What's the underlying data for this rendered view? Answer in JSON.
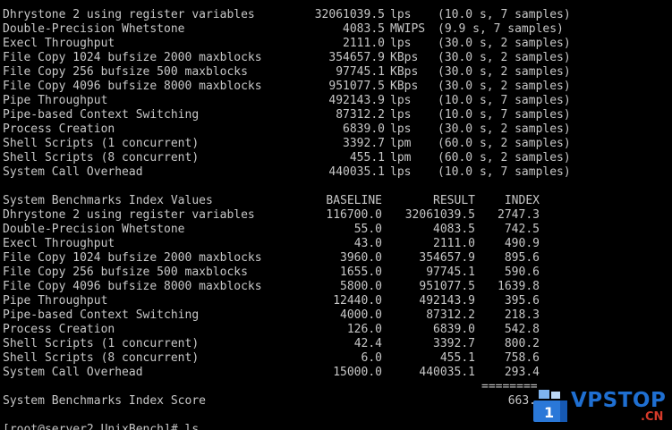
{
  "terminal": {
    "results": [
      {
        "name": "Dhrystone 2 using register variables",
        "value": "32061039.5",
        "unit": "lps",
        "detail": "(10.0 s, 7 samples)"
      },
      {
        "name": "Double-Precision Whetstone",
        "value": "4083.5",
        "unit": "MWIPS",
        "detail": "(9.9 s, 7 samples)"
      },
      {
        "name": "Execl Throughput",
        "value": "2111.0",
        "unit": "lps",
        "detail": "(30.0 s, 2 samples)"
      },
      {
        "name": "File Copy 1024 bufsize 2000 maxblocks",
        "value": "354657.9",
        "unit": "KBps",
        "detail": "(30.0 s, 2 samples)"
      },
      {
        "name": "File Copy 256 bufsize 500 maxblocks",
        "value": "97745.1",
        "unit": "KBps",
        "detail": "(30.0 s, 2 samples)"
      },
      {
        "name": "File Copy 4096 bufsize 8000 maxblocks",
        "value": "951077.5",
        "unit": "KBps",
        "detail": "(30.0 s, 2 samples)"
      },
      {
        "name": "Pipe Throughput",
        "value": "492143.9",
        "unit": "lps",
        "detail": "(10.0 s, 7 samples)"
      },
      {
        "name": "Pipe-based Context Switching",
        "value": "87312.2",
        "unit": "lps",
        "detail": "(10.0 s, 7 samples)"
      },
      {
        "name": "Process Creation",
        "value": "6839.0",
        "unit": "lps",
        "detail": "(30.0 s, 2 samples)"
      },
      {
        "name": "Shell Scripts (1 concurrent)",
        "value": "3392.7",
        "unit": "lpm",
        "detail": "(60.0 s, 2 samples)"
      },
      {
        "name": "Shell Scripts (8 concurrent)",
        "value": "455.1",
        "unit": "lpm",
        "detail": "(60.0 s, 2 samples)"
      },
      {
        "name": "System Call Overhead",
        "value": "440035.1",
        "unit": "lps",
        "detail": "(10.0 s, 7 samples)"
      }
    ],
    "index_header": {
      "title": "System Benchmarks Index Values",
      "baseline": "BASELINE",
      "result": "RESULT",
      "index": "INDEX"
    },
    "index_rows": [
      {
        "name": "Dhrystone 2 using register variables",
        "baseline": "116700.0",
        "result": "32061039.5",
        "index": "2747.3"
      },
      {
        "name": "Double-Precision Whetstone",
        "baseline": "55.0",
        "result": "4083.5",
        "index": "742.5"
      },
      {
        "name": "Execl Throughput",
        "baseline": "43.0",
        "result": "2111.0",
        "index": "490.9"
      },
      {
        "name": "File Copy 1024 bufsize 2000 maxblocks",
        "baseline": "3960.0",
        "result": "354657.9",
        "index": "895.6"
      },
      {
        "name": "File Copy 256 bufsize 500 maxblocks",
        "baseline": "1655.0",
        "result": "97745.1",
        "index": "590.6"
      },
      {
        "name": "File Copy 4096 bufsize 8000 maxblocks",
        "baseline": "5800.0",
        "result": "951077.5",
        "index": "1639.8"
      },
      {
        "name": "Pipe Throughput",
        "baseline": "12440.0",
        "result": "492143.9",
        "index": "395.6"
      },
      {
        "name": "Pipe-based Context Switching",
        "baseline": "4000.0",
        "result": "87312.2",
        "index": "218.3"
      },
      {
        "name": "Process Creation",
        "baseline": "126.0",
        "result": "6839.0",
        "index": "542.8"
      },
      {
        "name": "Shell Scripts (1 concurrent)",
        "baseline": "42.4",
        "result": "3392.7",
        "index": "800.2"
      },
      {
        "name": "Shell Scripts (8 concurrent)",
        "baseline": "6.0",
        "result": "455.1",
        "index": "758.6"
      },
      {
        "name": "System Call Overhead",
        "baseline": "15000.0",
        "result": "440035.1",
        "index": "293.4"
      }
    ],
    "separator": "========",
    "score_label": "System Benchmarks Index Score",
    "score_value": "663.",
    "prompt": "[root@server2 UnixBench]# ls"
  },
  "watermark": {
    "brand": "VPSTOP",
    "suffix": ".CN",
    "icon_digit": "1",
    "icon": "vpstop-logo-icon",
    "brand_color": "#1f6fd1",
    "suffix_color": "#d63a2a"
  }
}
